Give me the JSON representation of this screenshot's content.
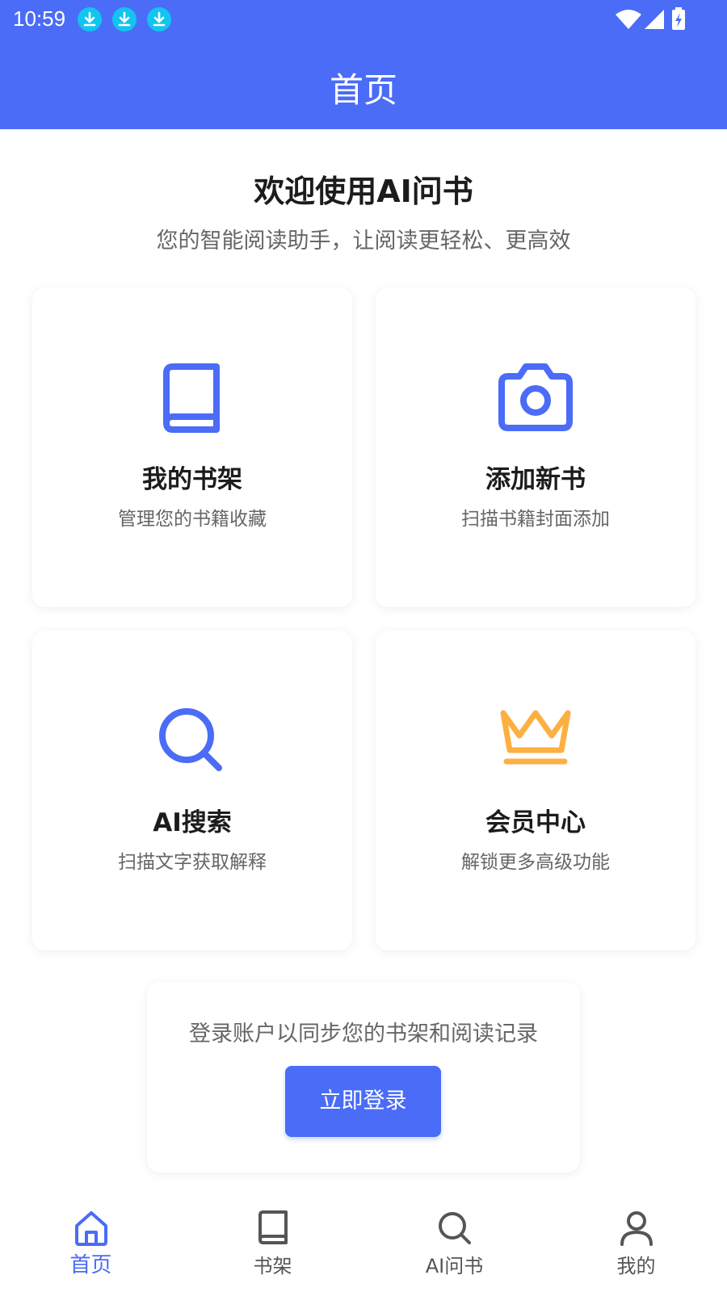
{
  "status_bar": {
    "time": "10:59"
  },
  "app_bar": {
    "title": "首页"
  },
  "welcome": {
    "title": "欢迎使用AI问书",
    "subtitle": "您的智能阅读助手，让阅读更轻松、更高效"
  },
  "features": [
    {
      "title": "我的书架",
      "desc": "管理您的书籍收藏",
      "icon": "book-icon",
      "color": "#4a6cf7"
    },
    {
      "title": "添加新书",
      "desc": "扫描书籍封面添加",
      "icon": "camera-icon",
      "color": "#4a6cf7"
    },
    {
      "title": "AI搜索",
      "desc": "扫描文字获取解释",
      "icon": "search-icon",
      "color": "#4a6cf7"
    },
    {
      "title": "会员中心",
      "desc": "解锁更多高级功能",
      "icon": "crown-icon",
      "color": "#fbb041"
    }
  ],
  "login": {
    "prompt": "登录账户以同步您的书架和阅读记录",
    "button": "立即登录"
  },
  "tabs": [
    {
      "label": "首页",
      "icon": "home-icon",
      "active": true
    },
    {
      "label": "书架",
      "icon": "book-icon",
      "active": false
    },
    {
      "label": "AI问书",
      "icon": "search-icon",
      "active": false
    },
    {
      "label": "我的",
      "icon": "user-icon",
      "active": false
    }
  ],
  "colors": {
    "primary": "#4a6cf7",
    "accent": "#fbb041",
    "download_badge": "#12c4f0"
  }
}
